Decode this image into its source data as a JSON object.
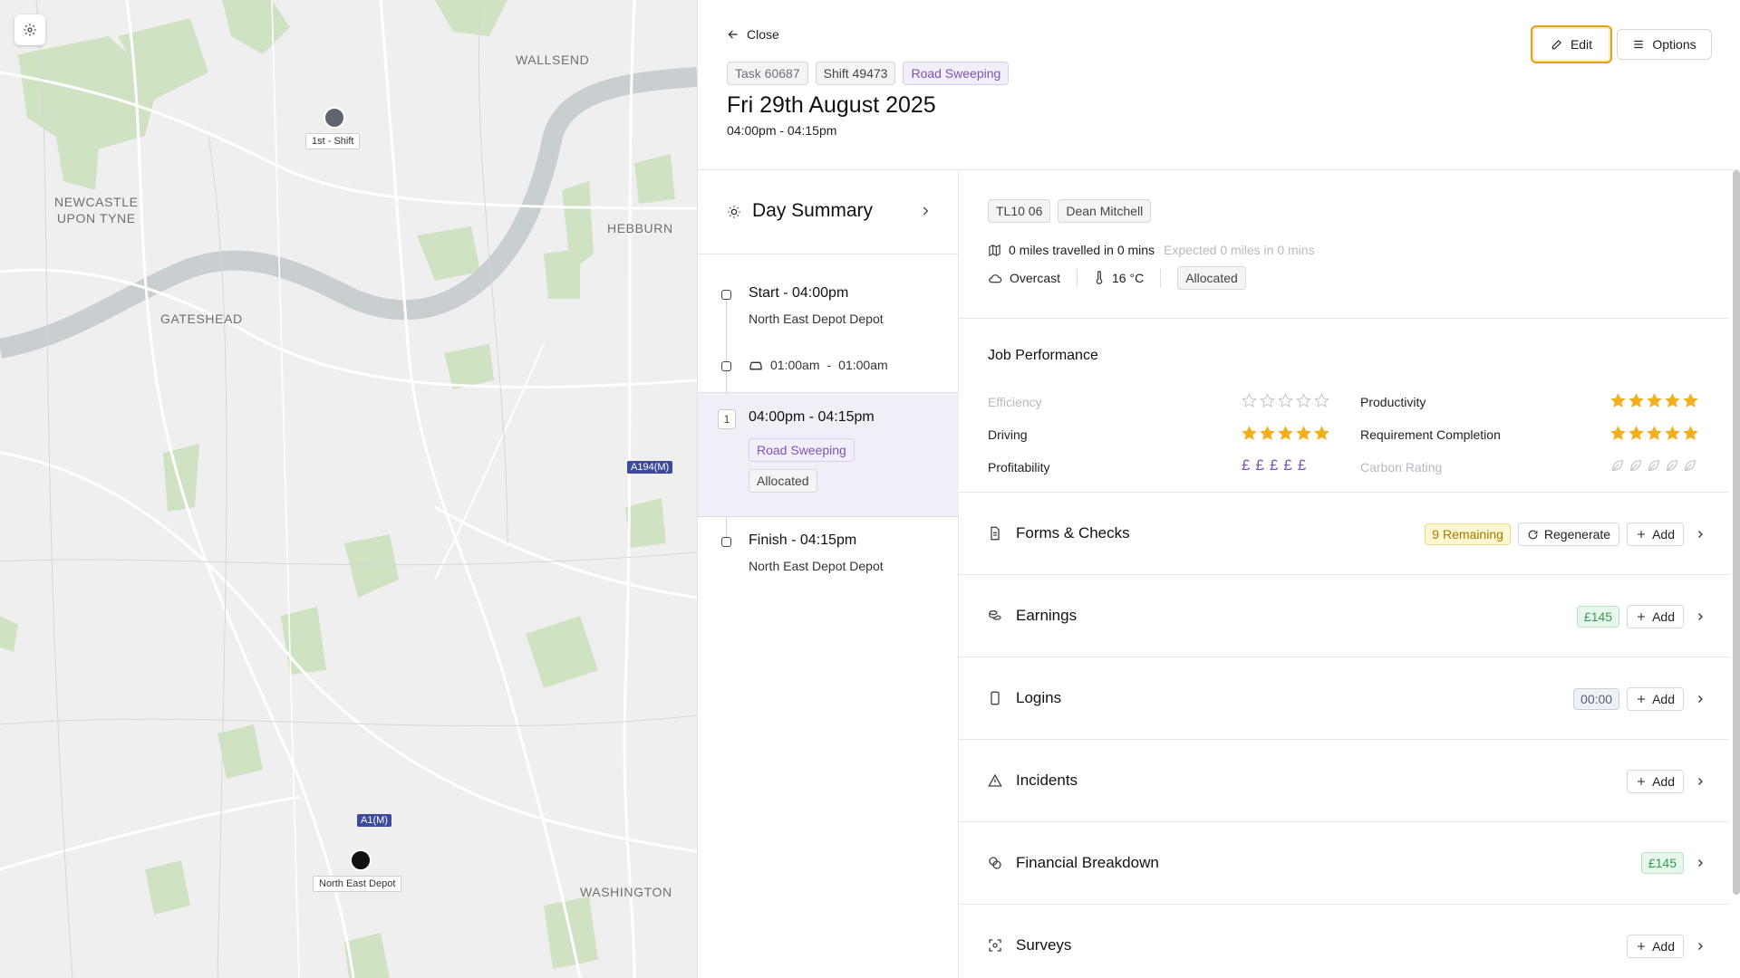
{
  "map": {
    "places": {
      "wallsend": "WALLSEND",
      "newcastle": "NEWCASTLE\nUPON TYNE",
      "hebburn": "HEBBURN",
      "gateshead": "GATESHEAD",
      "washington": "WASHINGTON"
    },
    "roads": {
      "a194m": "A194(M)",
      "a1m": "A1(M)"
    },
    "markers": {
      "shift": {
        "label": "1st - Shift",
        "color": "#5f6470"
      },
      "depot": {
        "label": "North East Depot",
        "color": "#111111"
      }
    },
    "settings_icon": "gear-icon"
  },
  "header": {
    "close_label": "Close",
    "tags": [
      "Task 60687",
      "Shift 49473",
      "Road Sweeping"
    ],
    "date": "Fri 29th August 2025",
    "time_range": "04:00pm - 04:15pm",
    "edit_label": "Edit",
    "options_label": "Options"
  },
  "timeline": {
    "day_summary": "Day Summary",
    "start": {
      "title": "Start - 04:00pm",
      "location": "North East Depot Depot"
    },
    "travel": {
      "from": "01:00am",
      "separator": "-",
      "to": "01:00am"
    },
    "task": {
      "number": "1",
      "time": "04:00pm - 04:15pm",
      "type": "Road Sweeping",
      "status": "Allocated"
    },
    "finish": {
      "title": "Finish - 04:15pm",
      "location": "North East Depot Depot"
    }
  },
  "details": {
    "vehicle": "TL10 06",
    "driver": "Dean Mitchell",
    "miles": "0 miles travelled in 0 mins",
    "expected": "Expected 0 miles in 0 mins",
    "weather": "Overcast",
    "temperature": "16 °C",
    "status": "Allocated"
  },
  "performance": {
    "title": "Job Performance",
    "efficiency": {
      "label": "Efficiency",
      "rating": 0,
      "max": 5
    },
    "productivity": {
      "label": "Productivity",
      "rating": 5,
      "max": 5
    },
    "driving": {
      "label": "Driving",
      "rating": 5,
      "max": 5
    },
    "requirement_completion": {
      "label": "Requirement Completion",
      "rating": 5,
      "max": 5
    },
    "profitability": {
      "label": "Profitability",
      "symbols": [
        "£",
        "£",
        "£",
        "£",
        "£"
      ]
    },
    "carbon_rating": {
      "label": "Carbon Rating",
      "rating": 0,
      "max": 5
    },
    "accent": "#f2b01e",
    "profit_color": "#7a55b6"
  },
  "sections": {
    "forms": {
      "title": "Forms & Checks",
      "badge": "9 Remaining",
      "regenerate": "Regenerate",
      "add": "Add"
    },
    "earnings": {
      "title": "Earnings",
      "badge": "£145",
      "add": "Add"
    },
    "logins": {
      "title": "Logins",
      "badge": "00:00",
      "add": "Add"
    },
    "incidents": {
      "title": "Incidents",
      "add": "Add"
    },
    "financial": {
      "title": "Financial Breakdown",
      "badge": "£145"
    },
    "surveys": {
      "title": "Surveys",
      "add": "Add"
    }
  }
}
